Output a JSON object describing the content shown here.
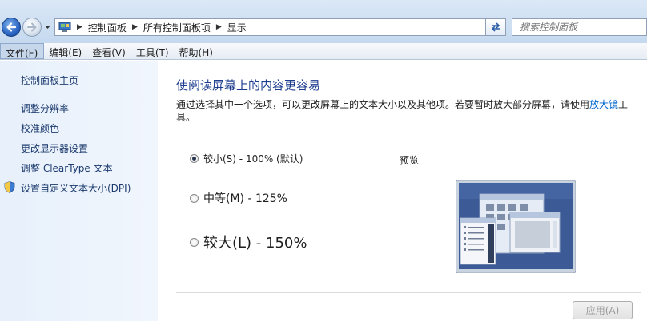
{
  "address": {
    "breadcrumbs": [
      "控制面板",
      "所有控制面板项",
      "显示"
    ],
    "search_placeholder": "搜索控制面板"
  },
  "menu": {
    "items": [
      "文件(F)",
      "编辑(E)",
      "查看(V)",
      "工具(T)",
      "帮助(H)"
    ]
  },
  "sidebar": {
    "home": "控制面板主页",
    "links": [
      "调整分辨率",
      "校准颜色",
      "更改显示器设置",
      "调整 ClearType 文本",
      "设置自定义文本大小(DPI)"
    ]
  },
  "main": {
    "title": "使阅读屏幕上的内容更容易",
    "desc_before": "通过选择其中一个选项，可以更改屏幕上的文本大小以及其他项。若要暂时放大部分屏幕，请使用",
    "desc_link": "放大镜",
    "desc_after": "工具。",
    "options": [
      {
        "label": "较小(S) - 100% (默认)",
        "checked": true
      },
      {
        "label": "中等(M) - 125%",
        "checked": false
      },
      {
        "label": "较大(L) - 150%",
        "checked": false
      }
    ],
    "preview_label": "预览",
    "apply_label": "应用(A)"
  },
  "colors": {
    "title_blue": "#1e3d8f",
    "link_blue": "#1c3b6e",
    "pane_bg": "#e7f0fb"
  }
}
